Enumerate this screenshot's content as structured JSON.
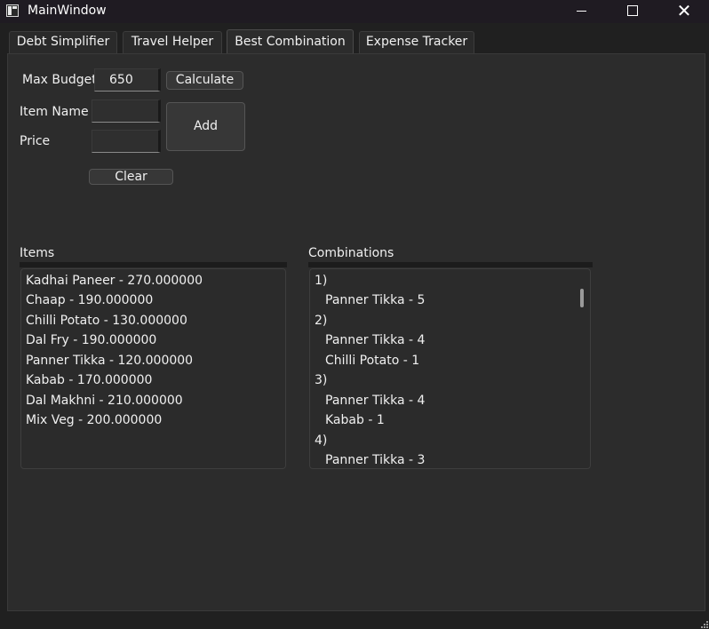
{
  "window": {
    "title": "MainWindow",
    "minimize_glyph": "",
    "close_glyph": "✕"
  },
  "tabs": [
    {
      "label": "Debt Simplifier",
      "active": false
    },
    {
      "label": "Travel Helper",
      "active": false
    },
    {
      "label": "Best Combination",
      "active": true
    },
    {
      "label": "Expense Tracker",
      "active": false
    }
  ],
  "form": {
    "max_budget_label": "Max Budget",
    "max_budget_value": "650",
    "calculate_label": "Calculate",
    "item_name_label": "Item Name",
    "item_name_value": "",
    "price_label": "Price",
    "price_value": "",
    "add_label": "Add",
    "clear_label": "Clear"
  },
  "items": {
    "header": "Items",
    "rows": [
      "Kadhai Paneer - 270.000000",
      "Chaap - 190.000000",
      "Chilli Potato - 130.000000",
      "Dal Fry - 190.000000",
      "Panner Tikka - 120.000000",
      "Kabab - 170.000000",
      "Dal Makhni - 210.000000",
      "Mix Veg - 200.000000"
    ]
  },
  "combinations": {
    "header": "Combinations",
    "rows": [
      {
        "text": "1)",
        "indent": false
      },
      {
        "text": "Panner Tikka - 5",
        "indent": true
      },
      {
        "text": "2)",
        "indent": false
      },
      {
        "text": "Panner Tikka - 4",
        "indent": true
      },
      {
        "text": "Chilli Potato - 1",
        "indent": true
      },
      {
        "text": "3)",
        "indent": false
      },
      {
        "text": "Panner Tikka - 4",
        "indent": true
      },
      {
        "text": "Kabab - 1",
        "indent": true
      },
      {
        "text": "4)",
        "indent": false
      },
      {
        "text": "Panner Tikka - 3",
        "indent": true
      }
    ]
  },
  "colors": {
    "background": "#202020",
    "panel": "#2c2c2c",
    "titlebar": "#1f1b22",
    "text": "#f0f0f0"
  }
}
